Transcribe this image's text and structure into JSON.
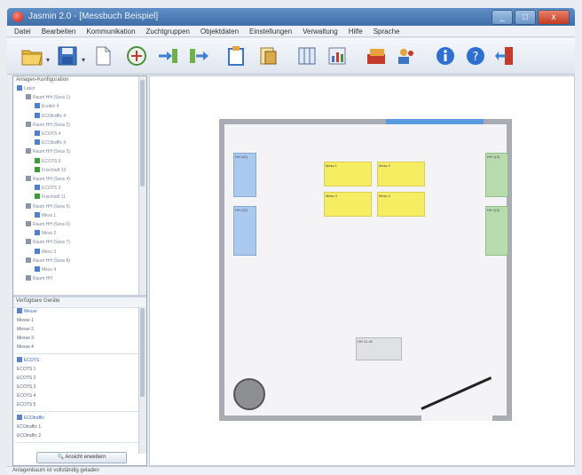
{
  "window": {
    "title": "Jasmin 2.0 - [Messbuch Beispiel]",
    "buttons": [
      "_",
      "□",
      "x"
    ]
  },
  "menu": [
    "Datei",
    "Bearbeiten",
    "Kommunikation",
    "Zuchtgruppen",
    "Objektdaten",
    "Einstellungen",
    "Verwaltung",
    "Hilfe",
    "Sprache"
  ],
  "toolbar": {
    "icons": [
      "open-folder-icon",
      "save-icon",
      "new-document-icon",
      "connect-icon",
      "import-icon",
      "export-icon",
      "clipboard-icon",
      "document-icon",
      "columns-icon",
      "chart-icon",
      "devices-icon",
      "users-icon",
      "info-icon",
      "help-icon",
      "exit-icon"
    ]
  },
  "tree": {
    "header": "Anlagen-Konfiguration",
    "rows": [
      {
        "indent": 0,
        "label": "Labor",
        "icon": "blue"
      },
      {
        "indent": 1,
        "label": "Raum HH (Sess 1)",
        "icon": "gray"
      },
      {
        "indent": 2,
        "label": "Ecobin 4",
        "icon": "blue"
      },
      {
        "indent": 2,
        "label": "ECOtraffic 4",
        "icon": "blue"
      },
      {
        "indent": 1,
        "label": "Raum HH (Sess 2)",
        "icon": "gray"
      },
      {
        "indent": 2,
        "label": "ECOTS 4",
        "icon": "blue"
      },
      {
        "indent": 2,
        "label": "ECOtraffic 4",
        "icon": "blue"
      },
      {
        "indent": 1,
        "label": "Raum HH (Sess 3)",
        "icon": "gray"
      },
      {
        "indent": 2,
        "label": "ECOTS 5",
        "icon": "green"
      },
      {
        "indent": 2,
        "label": "Frischluft 10",
        "icon": "green"
      },
      {
        "indent": 1,
        "label": "Raum HH (Sess 4)",
        "icon": "gray"
      },
      {
        "indent": 2,
        "label": "ECOTS 3",
        "icon": "blue"
      },
      {
        "indent": 2,
        "label": "Frischluft 11",
        "icon": "green"
      },
      {
        "indent": 1,
        "label": "Raum HH (Sess 5)",
        "icon": "gray"
      },
      {
        "indent": 2,
        "label": "Mess 1",
        "icon": "blue"
      },
      {
        "indent": 1,
        "label": "Raum HH (Sess 6)",
        "icon": "gray"
      },
      {
        "indent": 2,
        "label": "Mess 2",
        "icon": "blue"
      },
      {
        "indent": 1,
        "label": "Raum HH (Sess 7)",
        "icon": "gray"
      },
      {
        "indent": 2,
        "label": "Mess 3",
        "icon": "blue"
      },
      {
        "indent": 1,
        "label": "Raum HH (Sess 8)",
        "icon": "gray"
      },
      {
        "indent": 2,
        "label": "Mess 4",
        "icon": "blue"
      },
      {
        "indent": 1,
        "label": "Raum HH",
        "icon": "gray"
      }
    ]
  },
  "list": {
    "header": "Verfügbare Geräte",
    "groups": [
      {
        "label": "Messe",
        "items": [
          "Messe 1",
          "Messe 2",
          "Messe 3",
          "Messe 4"
        ]
      },
      {
        "label": "ECOTS",
        "items": [
          "ECOTS 1",
          "ECOTS 2",
          "ECOTS 3",
          "ECOTS 4",
          "ECOTS 5"
        ]
      },
      {
        "label": "ECOtraffic",
        "items": [
          "ECOtraffic 1",
          "ECOtraffic 2"
        ]
      }
    ],
    "button": "Ansicht erweitern"
  },
  "canvas": {
    "nodes": [
      {
        "color": "blue",
        "label": "HH 1(1)"
      },
      {
        "color": "blue",
        "label": "HH 1(2)"
      },
      {
        "color": "yellow",
        "label": "Mess 1"
      },
      {
        "color": "yellow",
        "label": "Mess 2"
      },
      {
        "color": "yellow",
        "label": "Mess 3"
      },
      {
        "color": "yellow",
        "label": "Mess 4"
      },
      {
        "color": "green",
        "label": "HH 1(3)"
      },
      {
        "color": "green",
        "label": "HH 1(4)"
      },
      {
        "color": "gray",
        "label": "HH 12.40"
      }
    ]
  },
  "status": {
    "text": "Anlagenbaum ist vollständig geladen"
  }
}
